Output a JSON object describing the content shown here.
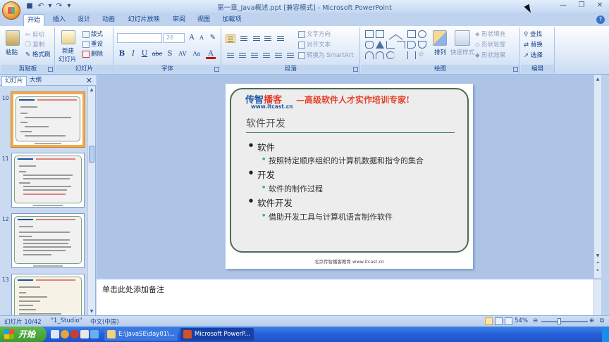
{
  "window": {
    "title": "第一章_Java概述.ppt [兼容模式] - Microsoft PowerPoint"
  },
  "ribbon_tabs": [
    "开始",
    "插入",
    "设计",
    "动画",
    "幻灯片放映",
    "审阅",
    "视图",
    "加载项"
  ],
  "ribbon": {
    "clipboard": {
      "paste": "粘贴",
      "cut": "剪切",
      "copy": "复制",
      "format_painter": "格式刷",
      "label": "剪贴板"
    },
    "slides": {
      "new_slide": "新建",
      "new_slide_2": "幻灯片",
      "layout": "版式",
      "reset": "重设",
      "delete": "删除",
      "label": "幻灯片"
    },
    "font": {
      "font_size": "26",
      "bold": "B",
      "italic": "I",
      "underline": "U",
      "strike": "abe",
      "shadow": "S",
      "spacing": "AV",
      "case": "Aa",
      "label": "字体"
    },
    "paragraph": {
      "text_direction": "文字方向",
      "align_text": "对齐文本",
      "smartart": "转换为 SmartArt",
      "label": "段落"
    },
    "drawing": {
      "arrange": "排列",
      "quick_styles": "快速样式",
      "shape_fill": "形状填充",
      "shape_outline": "形状轮廓",
      "shape_effects": "形状效果",
      "label": "绘图"
    },
    "editing": {
      "find": "查找",
      "replace": "替换",
      "select": "选择",
      "label": "编辑"
    }
  },
  "left_panel": {
    "tabs": [
      "幻灯片",
      "大纲"
    ],
    "slide_numbers": [
      "10",
      "11",
      "12",
      "13"
    ]
  },
  "slide": {
    "logo_1": "传智",
    "logo_2": "播客",
    "logo_url": "www.itcast.cn",
    "slogan": "—高级软件人才实作培训专家!",
    "title": "软件开发",
    "bullets": [
      {
        "text": "软件",
        "sub": "按照特定顺序组织的计算机数据和指令的集合"
      },
      {
        "text": "开发",
        "sub": "软件的制作过程"
      },
      {
        "text": "软件开发",
        "sub": "借助开发工具与计算机语言制作软件"
      }
    ],
    "footer": "北京传智播客教育 www.itcast.cn"
  },
  "notes": {
    "placeholder": "单击此处添加备注"
  },
  "status_bar": {
    "slide_info": "幻灯片 10/42",
    "theme": "\"1_Studio\"",
    "language": "中文(中国)",
    "zoom": "54%"
  },
  "taskbar": {
    "start": "开始",
    "tasks": [
      "E:\\JavaSE\\day01\\...",
      "Microsoft PowerP..."
    ]
  },
  "colors": {
    "ribbon_bg": "#dbe7f7",
    "accent_orange": "#f2a94a",
    "logo_blue": "#1d58a8",
    "logo_red": "#e4402a",
    "taskbar_blue": "#245edb"
  }
}
